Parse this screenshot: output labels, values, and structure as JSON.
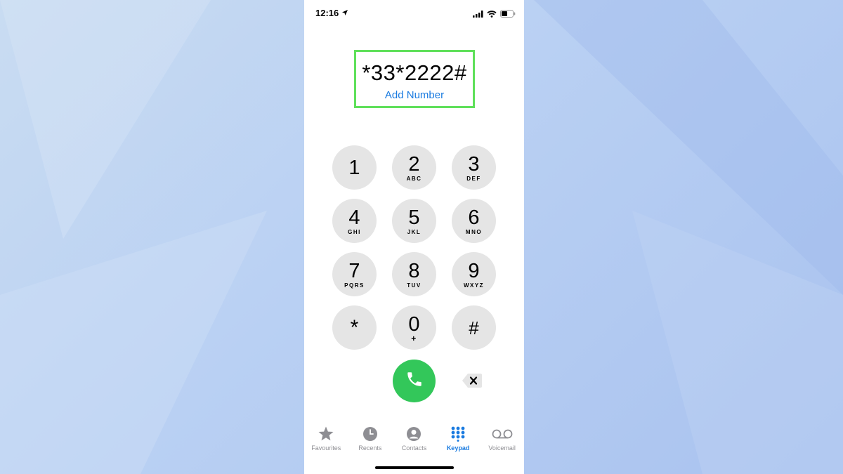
{
  "status_bar": {
    "time": "12:16"
  },
  "dialer": {
    "number": "*33*2222#",
    "add_number_label": "Add Number"
  },
  "keypad": [
    {
      "digit": "1",
      "letters": ""
    },
    {
      "digit": "2",
      "letters": "ABC"
    },
    {
      "digit": "3",
      "letters": "DEF"
    },
    {
      "digit": "4",
      "letters": "GHI"
    },
    {
      "digit": "5",
      "letters": "JKL"
    },
    {
      "digit": "6",
      "letters": "MNO"
    },
    {
      "digit": "7",
      "letters": "PQRS"
    },
    {
      "digit": "8",
      "letters": "TUV"
    },
    {
      "digit": "9",
      "letters": "WXYZ"
    },
    {
      "digit": "*",
      "letters": ""
    },
    {
      "digit": "0",
      "letters": "+"
    },
    {
      "digit": "#",
      "letters": ""
    }
  ],
  "tab_bar": {
    "items": [
      {
        "label": "Favourites",
        "icon": "star-icon"
      },
      {
        "label": "Recents",
        "icon": "clock-icon"
      },
      {
        "label": "Contacts",
        "icon": "person-icon"
      },
      {
        "label": "Keypad",
        "icon": "keypad-icon",
        "active": true
      },
      {
        "label": "Voicemail",
        "icon": "voicemail-icon"
      }
    ]
  },
  "colors": {
    "accent": "#1a7be0",
    "call_green": "#33c75a",
    "highlight_box": "#5fe05a",
    "key_bg": "#e5e5e5"
  }
}
